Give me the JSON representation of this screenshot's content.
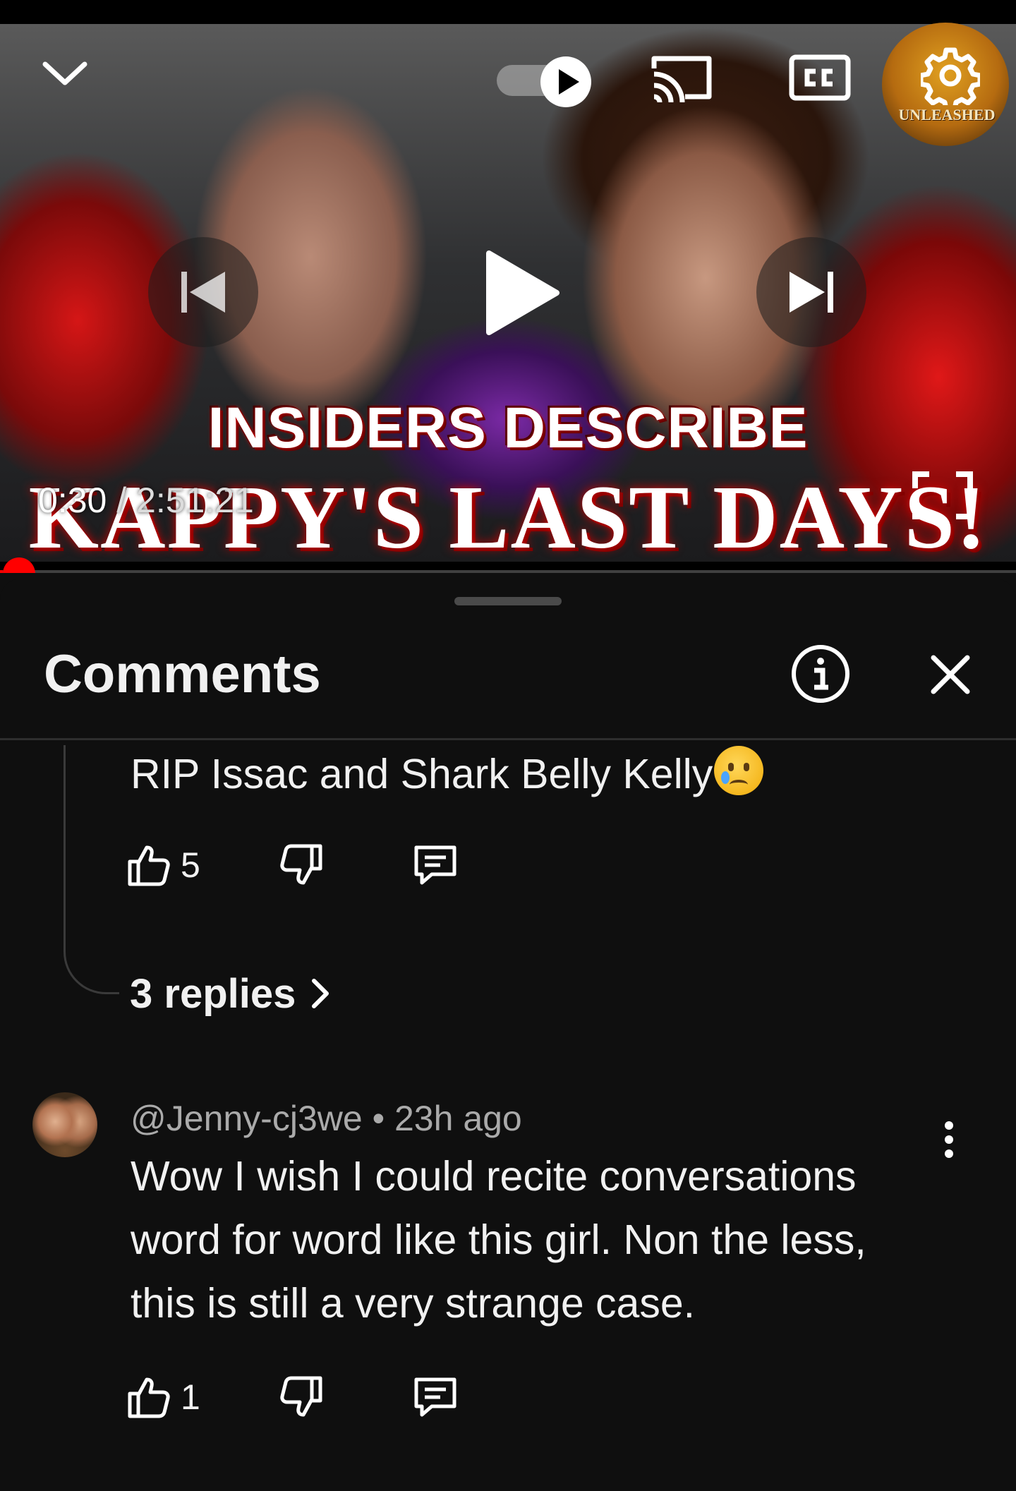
{
  "player": {
    "thumbnail_line1": "INSIDERS DESCRIBE",
    "thumbnail_line2": "KAPPY'S LAST DAYS!",
    "thumbnail_logo_text": "UNLEASHED",
    "time_current": "0:30",
    "time_separator": " / ",
    "time_total": "2:51:21",
    "progress_fraction": 0.0029,
    "autoplay": "on",
    "icons": {
      "collapse": "chevron-down-icon",
      "autoplay": "autoplay-toggle-icon",
      "cast": "cast-icon",
      "captions": "cc-icon",
      "settings": "gear-icon",
      "previous": "skip-previous-icon",
      "play": "play-icon",
      "next": "skip-next-icon",
      "fullscreen": "fullscreen-icon"
    },
    "accent_color": "#ff0000"
  },
  "comments_panel": {
    "title": "Comments",
    "icons": {
      "info": "info-icon",
      "close": "close-icon"
    },
    "items": [
      {
        "text": "RIP Issac and Shark Belly Kelly",
        "emoji": "crying-face",
        "likes": "5",
        "replies_label": "3 replies"
      },
      {
        "author": "@Jenny-cj3we",
        "separator": "•",
        "time_ago": "23h ago",
        "text_lines": [
          "Wow I wish I could recite conversations",
          "word for word like this girl. Non the less,",
          "this is still a very strange case."
        ],
        "likes": "1"
      }
    ]
  }
}
